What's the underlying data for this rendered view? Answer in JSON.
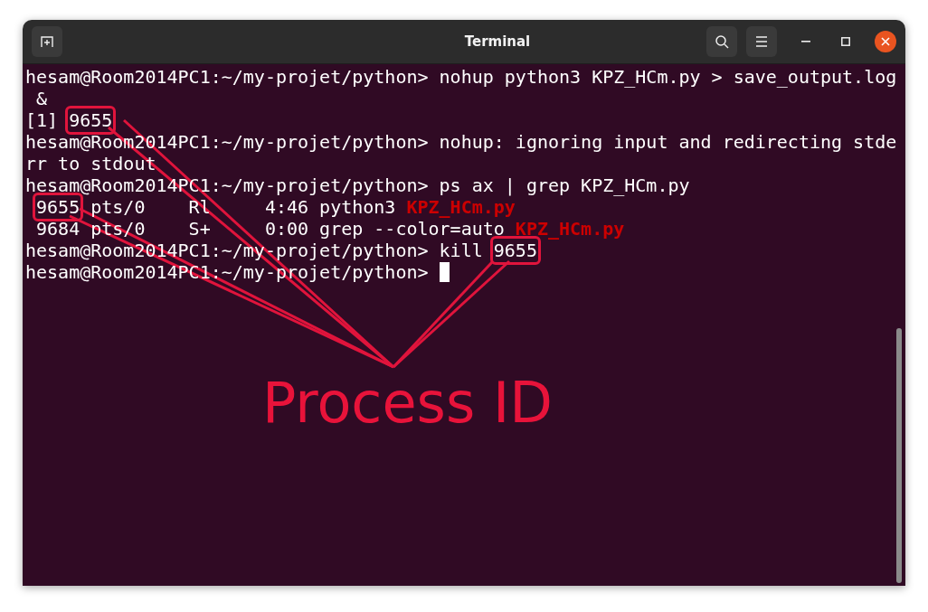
{
  "window": {
    "title": "Terminal"
  },
  "terminal": {
    "rows": [
      {
        "segments": [
          {
            "text": "hesam@Room2014PC1:~/my-projet/python> nohup python3 KPZ_HCm.py > save_output.log",
            "kind": "plain"
          }
        ]
      },
      {
        "segments": [
          {
            "text": " &",
            "kind": "plain"
          }
        ]
      },
      {
        "segments": [
          {
            "text": "[1] ",
            "kind": "plain"
          },
          {
            "text": "9655",
            "kind": "boxed"
          }
        ]
      },
      {
        "segments": [
          {
            "text": "hesam@Room2014PC1:~/my-projet/python> nohup: ignoring input and redirecting stde",
            "kind": "plain"
          }
        ]
      },
      {
        "segments": [
          {
            "text": "rr to stdout",
            "kind": "plain"
          }
        ]
      },
      {
        "segments": [
          {
            "text": "hesam@Room2014PC1:~/my-projet/python> ps ax | grep KPZ_HCm.py",
            "kind": "plain"
          }
        ]
      },
      {
        "indent": true,
        "segments": [
          {
            "text": "9655",
            "kind": "boxed"
          },
          {
            "text": " pts/0    Rl     4:46 python3 ",
            "kind": "plain"
          },
          {
            "text": "KPZ_HCm.py",
            "kind": "match"
          }
        ]
      },
      {
        "segments": [
          {
            "text": " 9684 pts/0    S+     0:00 grep --color=auto ",
            "kind": "plain"
          },
          {
            "text": "KPZ_HCm.py",
            "kind": "match"
          }
        ]
      },
      {
        "segments": [
          {
            "text": "hesam@Room2014PC1:~/my-projet/python> kill ",
            "kind": "plain"
          },
          {
            "text": "9655",
            "kind": "boxed"
          }
        ]
      },
      {
        "segments": [
          {
            "text": "hesam@Room2014PC1:~/my-projet/python> ",
            "kind": "plain"
          }
        ]
      }
    ]
  },
  "annotation": {
    "label": "Process ID"
  }
}
